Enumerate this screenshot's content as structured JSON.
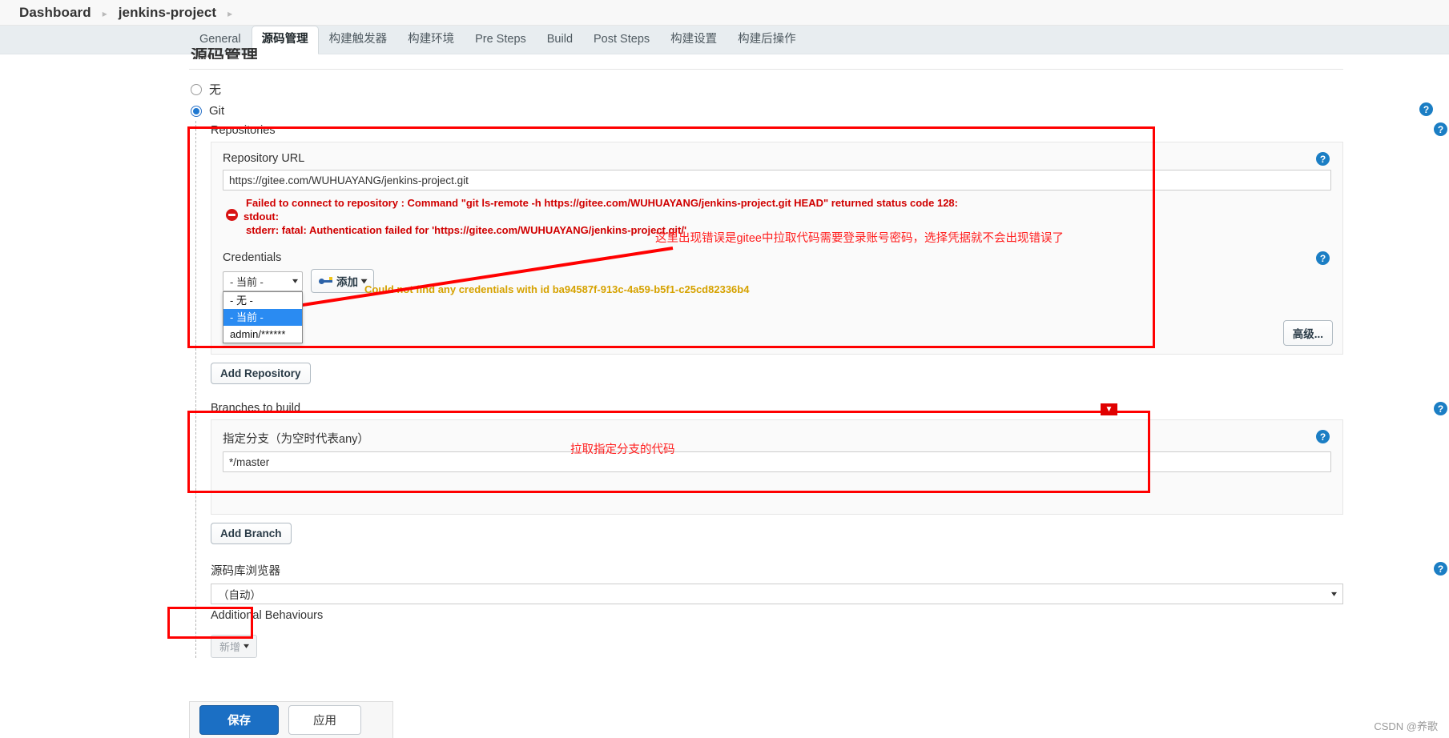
{
  "breadcrumb": {
    "items": [
      "Dashboard",
      "jenkins-project"
    ],
    "separator": "▸"
  },
  "tabs": [
    {
      "label": "General",
      "active": false
    },
    {
      "label": "源码管理",
      "active": true
    },
    {
      "label": "构建触发器",
      "active": false
    },
    {
      "label": "构建环境",
      "active": false
    },
    {
      "label": "Pre Steps",
      "active": false
    },
    {
      "label": "Build",
      "active": false
    },
    {
      "label": "Post Steps",
      "active": false
    },
    {
      "label": "构建设置",
      "active": false
    },
    {
      "label": "构建后操作",
      "active": false
    }
  ],
  "section": {
    "title": "源码管理"
  },
  "scm": {
    "options": [
      {
        "label": "无",
        "checked": false
      },
      {
        "label": "Git",
        "checked": true
      }
    ],
    "repositories_label": "Repositories",
    "repository_url_label": "Repository URL",
    "repository_url_value": "https://gitee.com/WUHUAYANG/jenkins-project.git",
    "error": {
      "line1": "Failed to connect to repository : Command \"git ls-remote -h https://gitee.com/WUHUAYANG/jenkins-project.git HEAD\" returned status code 128:",
      "line2": "stdout:",
      "line3": "stderr: fatal: Authentication failed for 'https://gitee.com/WUHUAYANG/jenkins-project.git/'"
    },
    "credentials_label": "Credentials",
    "credentials_value": "- 当前 -",
    "credentials_options": [
      {
        "label": "- 无 -",
        "selected": false
      },
      {
        "label": "- 当前 -",
        "selected": true
      },
      {
        "label": "admin/******",
        "selected": false
      }
    ],
    "add_credentials_label": "添加",
    "credentials_warning": "Could not find any credentials with id ba94587f-913c-4a59-b5f1-c25cd82336b4",
    "advanced_label": "高级...",
    "add_repository_label": "Add Repository",
    "branches_label": "Branches to build",
    "branch_spec_label": "指定分支（为空时代表any）",
    "branch_spec_value": "*/master",
    "add_branch_label": "Add Branch",
    "browser_label": "源码库浏览器",
    "browser_value": "（自动）",
    "additional_behaviours_label": "Additional Behaviours",
    "add_behaviour_label": "新增"
  },
  "annotations": {
    "credentials_note": "这里出现错误是gitee中拉取代码需要登录账号密码，选择凭据就不会出现错误了",
    "branch_note": "拉取指定分支的代码",
    "down_marker": "▼"
  },
  "footer": {
    "save_label": "保存",
    "apply_label": "应用"
  },
  "watermark": "CSDN @养歌",
  "help_icon_glyph": "?",
  "colors": {
    "accent": "#1b6fc4",
    "error": "#d00000",
    "warning": "#d6a200",
    "annotation": "#ff2020",
    "highlight": "#2a8bf2"
  }
}
